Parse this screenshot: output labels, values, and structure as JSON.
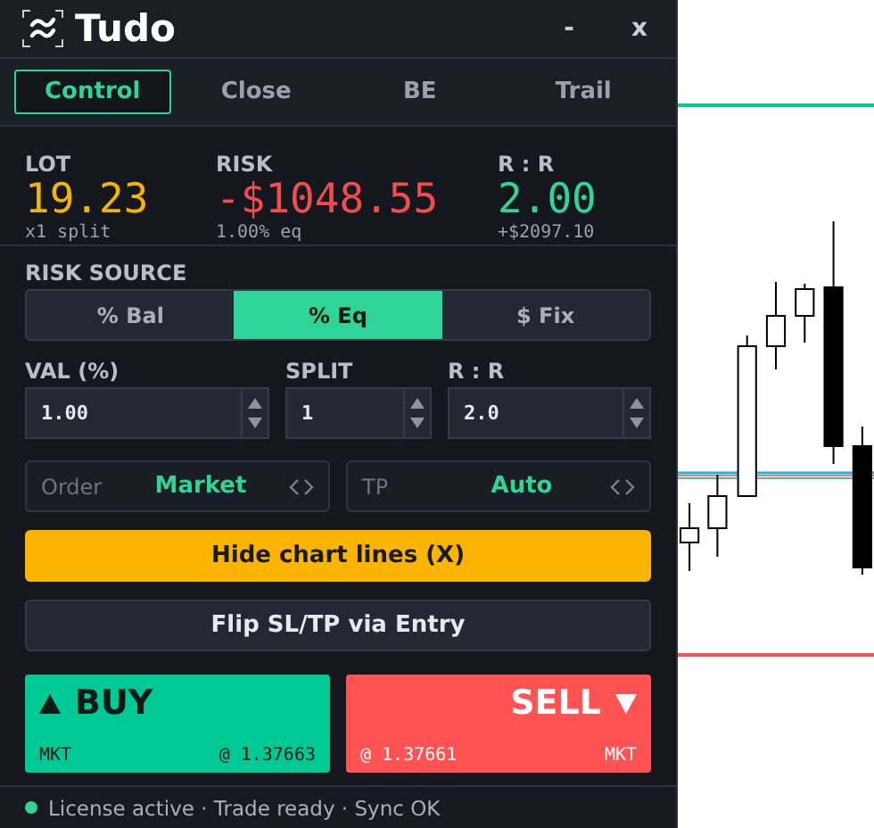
{
  "window": {
    "title": "Tudo",
    "controls": [
      "-",
      "x"
    ]
  },
  "tabs": [
    {
      "label": "Control",
      "selected": true
    },
    {
      "label": "Close",
      "selected": false
    },
    {
      "label": "BE",
      "selected": false
    },
    {
      "label": "Trail",
      "selected": false
    }
  ],
  "stats": [
    {
      "label": "LOT",
      "value": "19.23",
      "sub": "x1 split",
      "color": "#f5b400"
    },
    {
      "label": "RISK",
      "value": "-$1048.55",
      "sub": "1.00% eq",
      "color": "#f24c4c"
    },
    {
      "label": "R : R",
      "value": "2.00",
      "sub": "+$2097.10",
      "color": "#2fd49a"
    }
  ],
  "risk_source": {
    "label": "RISK SOURCE",
    "options": [
      {
        "label": "% Bal",
        "selected": false
      },
      {
        "label": "% Eq",
        "selected": true
      },
      {
        "label": "$ Fix",
        "selected": false
      }
    ]
  },
  "inputs": [
    {
      "label": "VAL (%)",
      "value": "1.00"
    },
    {
      "label": "SPLIT",
      "value": "1"
    },
    {
      "label": "R : R",
      "value": "2.0"
    }
  ],
  "selectors": [
    {
      "label": "Order",
      "value": "Market"
    },
    {
      "label": "TP",
      "value": "Auto"
    }
  ],
  "actions": [
    {
      "label": "Hide chart lines (X)",
      "kind": "primary"
    },
    {
      "label": "Flip SL/TP via Entry",
      "kind": "secondary"
    }
  ],
  "trade": [
    {
      "kind": "buy",
      "label": "BUY",
      "type": "MKT",
      "price": "@ 1.37663"
    },
    {
      "kind": "sell",
      "label": "SELL",
      "type": "MKT",
      "price": "@ 1.37661"
    }
  ],
  "status": {
    "active": true,
    "text": "License active · Trade ready · Sync OK"
  }
}
